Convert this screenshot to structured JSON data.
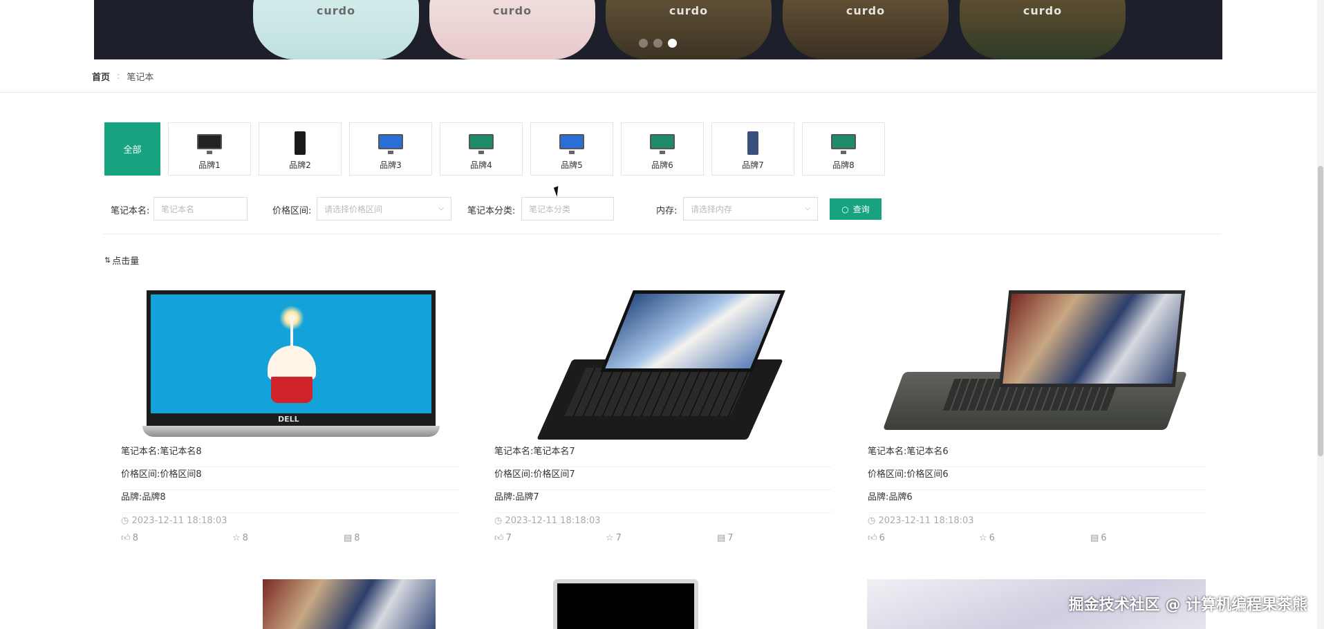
{
  "banner": {
    "brand_text": "curdo",
    "slide_count": 3,
    "active_slide": 3
  },
  "breadcrumb": {
    "home": "首页",
    "separator": ":",
    "current": "笔记本"
  },
  "categories": [
    {
      "label": "全部",
      "active": true
    },
    {
      "label": "品牌1"
    },
    {
      "label": "品牌2"
    },
    {
      "label": "品牌3"
    },
    {
      "label": "品牌4"
    },
    {
      "label": "品牌5"
    },
    {
      "label": "品牌6"
    },
    {
      "label": "品牌7"
    },
    {
      "label": "品牌8"
    }
  ],
  "filters": {
    "name_label": "笔记本名:",
    "name_placeholder": "笔记本名",
    "price_label": "价格区间:",
    "price_placeholder": "请选择价格区间",
    "category_label": "笔记本分类:",
    "category_placeholder": "笔记本分类",
    "memory_label": "内存:",
    "memory_placeholder": "请选择内存",
    "search_label": "查询"
  },
  "sort": {
    "label": "点击量"
  },
  "products": [
    {
      "name": "笔记本名:笔记本名8",
      "price": "价格区间:价格区间8",
      "brand": "品牌:品牌8",
      "date": "2023-12-11 18:18:03",
      "likes": "8",
      "favorites": "8",
      "comments": "8"
    },
    {
      "name": "笔记本名:笔记本名7",
      "price": "价格区间:价格区间7",
      "brand": "品牌:品牌7",
      "date": "2023-12-11 18:18:03",
      "likes": "7",
      "favorites": "7",
      "comments": "7"
    },
    {
      "name": "笔记本名:笔记本名6",
      "price": "价格区间:价格区间6",
      "brand": "品牌:品牌6",
      "date": "2023-12-11 18:18:03",
      "likes": "6",
      "favorites": "6",
      "comments": "6"
    }
  ],
  "watermark": "掘金技术社区 @ 计算机编程果茶熊",
  "colors": {
    "accent": "#17a37f",
    "banner_bg": "#1d1f2a"
  }
}
